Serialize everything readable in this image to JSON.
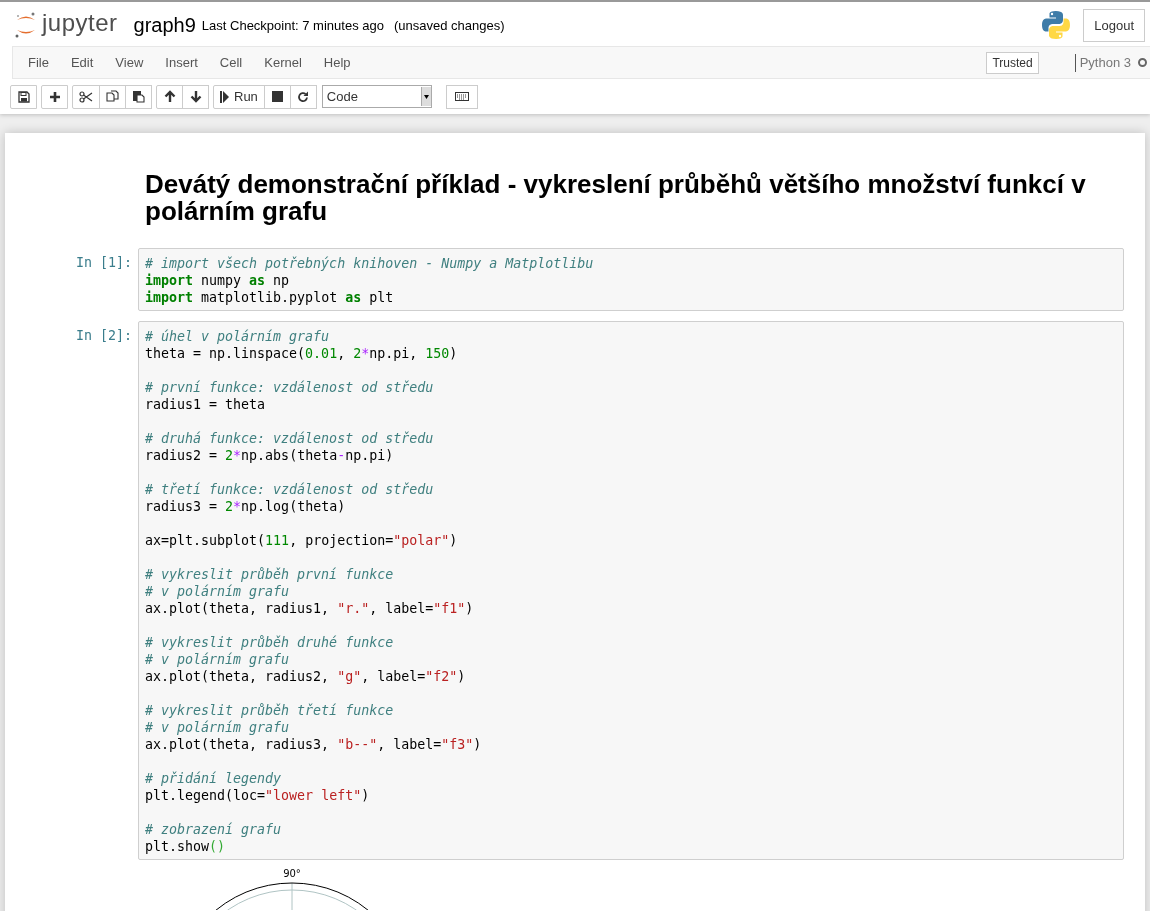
{
  "header": {
    "logo_text": "jupyter",
    "notebook_name": "graph9",
    "checkpoint": "Last Checkpoint: 7 minutes ago",
    "autosave_status": "(unsaved changes)",
    "logout": "Logout"
  },
  "menu": {
    "items": [
      "File",
      "Edit",
      "View",
      "Insert",
      "Cell",
      "Kernel",
      "Help"
    ],
    "trusted": "Trusted",
    "kernel_name": "Python 3",
    "kernel_busy": false
  },
  "toolbar": {
    "groups": [
      [
        {
          "kind": "save"
        }
      ],
      [
        {
          "kind": "add"
        }
      ],
      [
        {
          "kind": "cut"
        },
        {
          "kind": "copy"
        },
        {
          "kind": "paste"
        }
      ],
      [
        {
          "kind": "up"
        },
        {
          "kind": "down"
        }
      ],
      [
        {
          "kind": "run",
          "label": "Run"
        },
        {
          "kind": "stop"
        },
        {
          "kind": "restart"
        }
      ]
    ],
    "cell_type": "Code"
  },
  "heading": "Devátý demonstrační příklad - vykreslení průběhů většího množství funkcí v polárním grafu",
  "cells": [
    {
      "prompt": "In [1]:",
      "blocks": [
        [
          [
            {
              "kind": "comment",
              "text": "# import všech potřebných knihoven - Numpy a Matplotlibu"
            }
          ],
          [
            {
              "kind": "keyword",
              "text": "import"
            },
            {
              "kind": "plain",
              "text": " numpy "
            },
            {
              "kind": "keyword",
              "text": "as"
            },
            {
              "kind": "plain",
              "text": " np"
            }
          ],
          [
            {
              "kind": "keyword",
              "text": "import"
            },
            {
              "kind": "plain",
              "text": " matplotlib.pyplot "
            },
            {
              "kind": "keyword",
              "text": "as"
            },
            {
              "kind": "plain",
              "text": " plt"
            }
          ]
        ]
      ]
    },
    {
      "prompt": "In [2]:",
      "blocks": [
        [
          [
            {
              "kind": "comment",
              "text": "# úhel v polárním grafu"
            }
          ],
          [
            {
              "kind": "plain",
              "text": "theta = np.linspace("
            },
            {
              "kind": "number",
              "text": "0.01"
            },
            {
              "kind": "plain",
              "text": ", "
            },
            {
              "kind": "number",
              "text": "2"
            },
            {
              "kind": "operator",
              "text": "*"
            },
            {
              "kind": "plain",
              "text": "np.pi, "
            },
            {
              "kind": "number",
              "text": "150"
            },
            {
              "kind": "plain",
              "text": ")"
            }
          ]
        ],
        [
          [
            {
              "kind": "comment",
              "text": "# první funkce: vzdálenost od středu"
            }
          ],
          [
            {
              "kind": "plain",
              "text": "radius1 = theta"
            }
          ]
        ],
        [
          [
            {
              "kind": "comment",
              "text": "# druhá funkce: vzdálenost od středu"
            }
          ],
          [
            {
              "kind": "plain",
              "text": "radius2 = "
            },
            {
              "kind": "number",
              "text": "2"
            },
            {
              "kind": "operator",
              "text": "*"
            },
            {
              "kind": "plain",
              "text": "np.abs(theta"
            },
            {
              "kind": "operator",
              "text": "-"
            },
            {
              "kind": "plain",
              "text": "np.pi)"
            }
          ]
        ],
        [
          [
            {
              "kind": "comment",
              "text": "# třetí funkce: vzdálenost od středu"
            }
          ],
          [
            {
              "kind": "plain",
              "text": "radius3 = "
            },
            {
              "kind": "number",
              "text": "2"
            },
            {
              "kind": "operator",
              "text": "*"
            },
            {
              "kind": "plain",
              "text": "np.log(theta)"
            }
          ]
        ],
        [
          [
            {
              "kind": "plain",
              "text": "ax=plt.subplot("
            },
            {
              "kind": "number",
              "text": "111"
            },
            {
              "kind": "plain",
              "text": ", projection="
            },
            {
              "kind": "string",
              "text": "\"polar\""
            },
            {
              "kind": "plain",
              "text": ")"
            }
          ]
        ],
        [
          [
            {
              "kind": "comment",
              "text": "# vykreslit průběh první funkce"
            }
          ],
          [
            {
              "kind": "comment",
              "text": "# v polárním grafu"
            }
          ],
          [
            {
              "kind": "plain",
              "text": "ax.plot(theta, radius1, "
            },
            {
              "kind": "string",
              "text": "\"r.\""
            },
            {
              "kind": "plain",
              "text": ", label="
            },
            {
              "kind": "string",
              "text": "\"f1\""
            },
            {
              "kind": "plain",
              "text": ")"
            }
          ]
        ],
        [
          [
            {
              "kind": "comment",
              "text": "# vykreslit průběh druhé funkce"
            }
          ],
          [
            {
              "kind": "comment",
              "text": "# v polárním grafu"
            }
          ],
          [
            {
              "kind": "plain",
              "text": "ax.plot(theta, radius2, "
            },
            {
              "kind": "string",
              "text": "\"g\""
            },
            {
              "kind": "plain",
              "text": ", label="
            },
            {
              "kind": "string",
              "text": "\"f2\""
            },
            {
              "kind": "plain",
              "text": ")"
            }
          ]
        ],
        [
          [
            {
              "kind": "comment",
              "text": "# vykreslit průběh třetí funkce"
            }
          ],
          [
            {
              "kind": "comment",
              "text": "# v polárním grafu"
            }
          ],
          [
            {
              "kind": "plain",
              "text": "ax.plot(theta, radius3, "
            },
            {
              "kind": "string",
              "text": "\"b--\""
            },
            {
              "kind": "plain",
              "text": ", label="
            },
            {
              "kind": "string",
              "text": "\"f3\""
            },
            {
              "kind": "plain",
              "text": ")"
            }
          ]
        ],
        [
          [
            {
              "kind": "comment",
              "text": "# přidání legendy"
            }
          ],
          [
            {
              "kind": "plain",
              "text": "plt.legend(loc="
            },
            {
              "kind": "string",
              "text": "\"lower left\""
            },
            {
              "kind": "plain",
              "text": ")"
            }
          ]
        ],
        [
          [
            {
              "kind": "comment",
              "text": "# zobrazení grafu"
            }
          ],
          [
            {
              "kind": "plain",
              "text": "plt.show"
            },
            {
              "kind": "bracket",
              "text": "()"
            }
          ]
        ]
      ],
      "output": {
        "angle_label": "90°"
      }
    }
  ]
}
